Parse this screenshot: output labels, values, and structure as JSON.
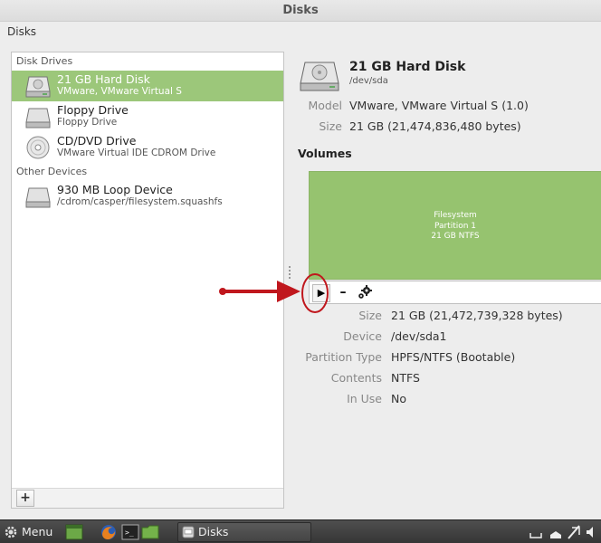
{
  "window": {
    "title": "Disks"
  },
  "menubar": {
    "app_menu": "Disks"
  },
  "sidebar": {
    "sections": [
      {
        "header": "Disk Drives"
      },
      {
        "header": "Other Devices"
      }
    ],
    "drives": [
      {
        "name": "21 GB Hard Disk",
        "sub": "VMware, VMware Virtual S",
        "icon": "hard-disk-icon",
        "selected": true
      },
      {
        "name": "Floppy Drive",
        "sub": "Floppy Drive",
        "icon": "floppy-drive-icon",
        "selected": false
      },
      {
        "name": "CD/DVD Drive",
        "sub": "VMware Virtual IDE CDROM Drive",
        "icon": "optical-disc-icon",
        "selected": false
      }
    ],
    "other_devices": [
      {
        "name": "930 MB Loop Device",
        "sub": "/cdrom/casper/filesystem.squashfs",
        "icon": "loop-device-icon"
      }
    ],
    "add_label": "+"
  },
  "disk": {
    "title": "21 GB Hard Disk",
    "device": "/dev/sda",
    "properties": [
      {
        "label": "Model",
        "value": "VMware, VMware Virtual S (1.0)"
      },
      {
        "label": "Size",
        "value": "21 GB (21,474,836,480 bytes)"
      }
    ]
  },
  "volumes": {
    "heading": "Volumes",
    "partition": {
      "line1": "Filesystem",
      "line2": "Partition 1",
      "line3": "21 GB NTFS"
    },
    "toolbar": {
      "play": "▶",
      "minus": "–"
    },
    "properties": [
      {
        "label": "Size",
        "value": "21 GB (21,472,739,328 bytes)"
      },
      {
        "label": "Device",
        "value": "/dev/sda1"
      },
      {
        "label": "Partition Type",
        "value": "HPFS/NTFS (Bootable)"
      },
      {
        "label": "Contents",
        "value": "NTFS"
      },
      {
        "label": "In Use",
        "value": "No"
      }
    ]
  },
  "taskbar": {
    "menu_label": "Menu",
    "window_button": "Disks"
  },
  "colors": {
    "selection": "#9cc77a",
    "partition": "#96c36f",
    "annotation": "#c0171d"
  }
}
